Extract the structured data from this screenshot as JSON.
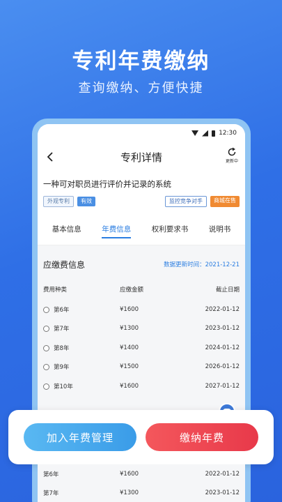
{
  "promo": {
    "headline": "专利年费缴纳",
    "subhead": "查询缴纳、方便快捷"
  },
  "status_bar": {
    "time": "12:30"
  },
  "header": {
    "title": "专利详情",
    "refresh_label": "更新中"
  },
  "patent": {
    "title": "一种可对职员进行评价并记录的系统",
    "type_tag": "外观专利",
    "status_tag": "有效",
    "monitor_tag": "监控竞争对手",
    "mall_tag": "商城在售"
  },
  "tabs": [
    {
      "label": "基本信息"
    },
    {
      "label": "年费信息"
    },
    {
      "label": "权利要求书"
    },
    {
      "label": "说明书"
    }
  ],
  "fees": {
    "section_title": "应缴费信息",
    "updated": "数据更新时间：2021-12-21",
    "columns": [
      "费用种类",
      "应缴金额",
      "截止日期"
    ],
    "rows": [
      {
        "type": "第6年",
        "amount": "¥1600",
        "due": "2022-01-12"
      },
      {
        "type": "第7年",
        "amount": "¥1300",
        "due": "2023-01-12"
      },
      {
        "type": "第8年",
        "amount": "¥1400",
        "due": "2024-01-12"
      },
      {
        "type": "第9年",
        "amount": "¥1500",
        "due": "2026-01-12"
      },
      {
        "type": "第10年",
        "amount": "¥1600",
        "due": "2027-01-12"
      }
    ],
    "lower_rows": [
      {
        "type": "第6年",
        "amount": "¥1600",
        "due": "2022-01-12"
      },
      {
        "type": "第7年",
        "amount": "¥1300",
        "due": "2023-01-12"
      }
    ]
  },
  "actions": {
    "manage_label": "加入年费管理",
    "pay_label": "缴纳年费"
  }
}
